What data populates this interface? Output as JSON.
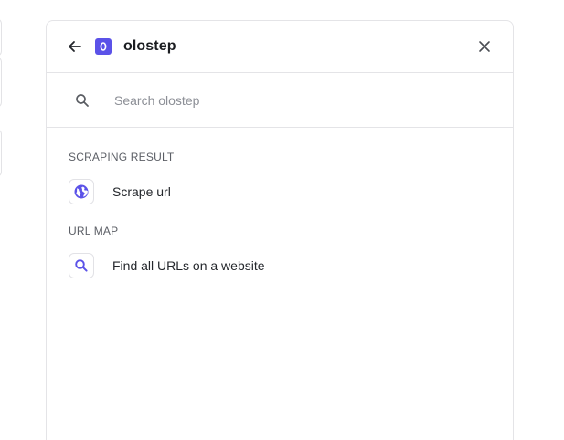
{
  "header": {
    "title": "olostep",
    "logo_letter": "o",
    "back_icon": "arrow-left-icon",
    "close_icon": "close-icon"
  },
  "search": {
    "placeholder": "Search olostep",
    "value": "",
    "icon": "search-icon"
  },
  "sections": [
    {
      "title": "SCRAPING RESULT",
      "items": [
        {
          "label": "Scrape url",
          "icon": "globe-icon"
        }
      ]
    },
    {
      "title": "URL MAP",
      "items": [
        {
          "label": "Find all URLs on a website",
          "icon": "search-icon"
        }
      ]
    }
  ],
  "colors": {
    "accent": "#5b52e8",
    "border": "#e4e4e7",
    "muted_text": "#5c5f66",
    "placeholder": "#8c8f96"
  }
}
